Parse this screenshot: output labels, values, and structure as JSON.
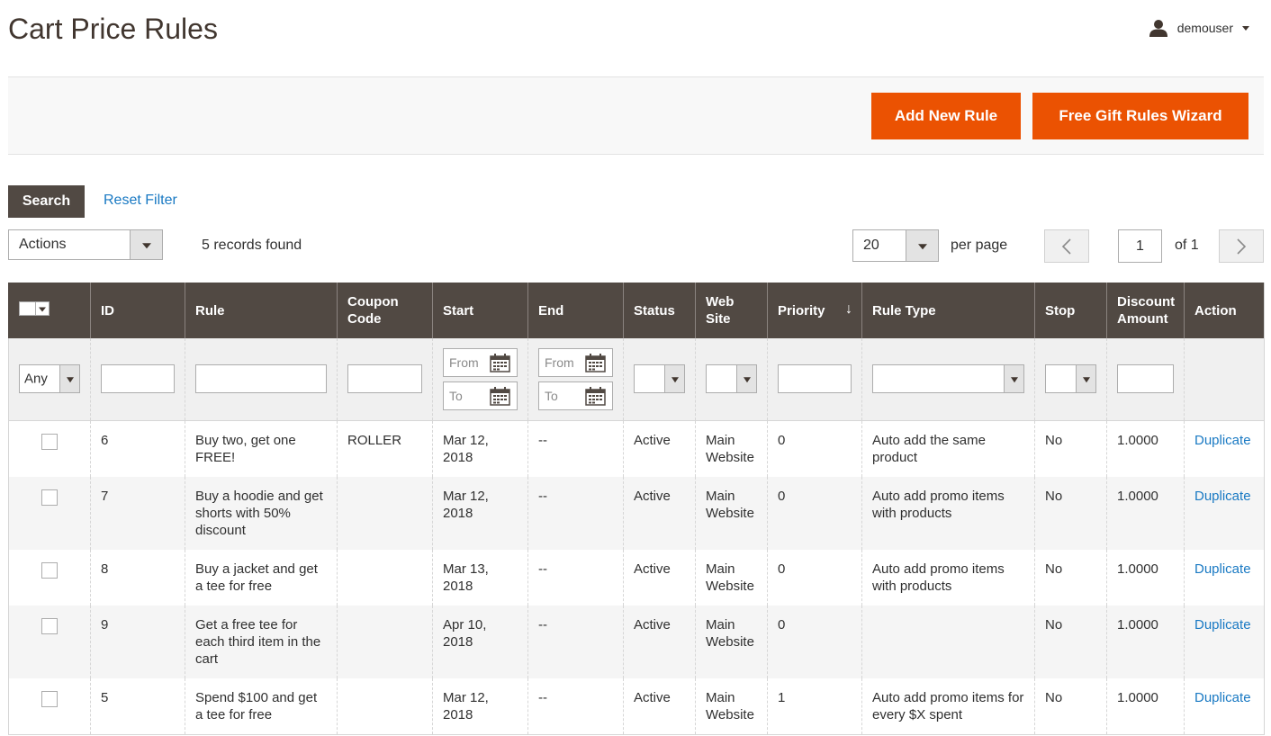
{
  "header": {
    "title": "Cart Price Rules",
    "username": "demouser"
  },
  "actions": {
    "add_new_rule": "Add New Rule",
    "free_gift_wizard": "Free Gift Rules Wizard"
  },
  "toolbar": {
    "search": "Search",
    "reset_filter": "Reset Filter",
    "mass_action": "Actions",
    "records_found": "5 records found",
    "per_page_value": "20",
    "per_page_label": "per page",
    "page_value": "1",
    "page_of": "of 1"
  },
  "columns": [
    "ID",
    "Rule",
    "Coupon Code",
    "Start",
    "End",
    "Status",
    "Web Site",
    "Priority",
    "Rule Type",
    "Stop",
    "Discount Amount",
    "Action"
  ],
  "filters": {
    "any": "Any",
    "from": "From",
    "to": "To"
  },
  "rows": [
    {
      "id": "6",
      "rule": "Buy two, get one FREE!",
      "coupon": "ROLLER",
      "start": "Mar 12, 2018",
      "end": "--",
      "status": "Active",
      "website": "Main Website",
      "priority": "0",
      "rule_type": "Auto add the same product",
      "stop": "No",
      "discount": "1.0000",
      "action": "Duplicate"
    },
    {
      "id": "7",
      "rule": "Buy a hoodie and get shorts with 50% discount",
      "coupon": "",
      "start": "Mar 12, 2018",
      "end": "--",
      "status": "Active",
      "website": "Main Website",
      "priority": "0",
      "rule_type": "Auto add promo items with products",
      "stop": "No",
      "discount": "1.0000",
      "action": "Duplicate"
    },
    {
      "id": "8",
      "rule": "Buy a jacket and get a tee for free",
      "coupon": "",
      "start": "Mar 13, 2018",
      "end": "--",
      "status": "Active",
      "website": "Main Website",
      "priority": "0",
      "rule_type": "Auto add promo items with products",
      "stop": "No",
      "discount": "1.0000",
      "action": "Duplicate"
    },
    {
      "id": "9",
      "rule": "Get a free tee for each third item in the cart",
      "coupon": "",
      "start": "Apr 10, 2018",
      "end": "--",
      "status": "Active",
      "website": "Main Website",
      "priority": "0",
      "rule_type": "",
      "stop": "No",
      "discount": "1.0000",
      "action": "Duplicate"
    },
    {
      "id": "5",
      "rule": "Spend $100 and get a tee for free",
      "coupon": "",
      "start": "Mar 12, 2018",
      "end": "--",
      "status": "Active",
      "website": "Main Website",
      "priority": "1",
      "rule_type": "Auto add promo items for every $X spent",
      "stop": "No",
      "discount": "1.0000",
      "action": "Duplicate"
    }
  ],
  "colors": {
    "accent": "#eb5202",
    "header_bg": "#514943",
    "link": "#1979c3"
  }
}
